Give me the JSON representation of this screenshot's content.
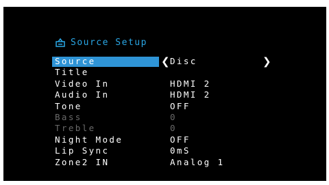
{
  "header": {
    "title": "Source Setup",
    "icon": "source-input-icon",
    "color": "#2aa7e6"
  },
  "selection_color": "#2f94d6",
  "menu": {
    "items": [
      {
        "label": "Source",
        "value": "Disc",
        "selected": true,
        "disabled": false
      },
      {
        "label": "Title",
        "value": "",
        "selected": false,
        "disabled": false
      },
      {
        "label": "Video In",
        "value": "HDMI 2",
        "selected": false,
        "disabled": false
      },
      {
        "label": "Audio In",
        "value": "HDMI 2",
        "selected": false,
        "disabled": false
      },
      {
        "label": "Tone",
        "value": "OFF",
        "selected": false,
        "disabled": false
      },
      {
        "label": "Bass",
        "value": "0",
        "selected": false,
        "disabled": true
      },
      {
        "label": "Treble",
        "value": "0",
        "selected": false,
        "disabled": true
      },
      {
        "label": "Night Mode",
        "value": "OFF",
        "selected": false,
        "disabled": false
      },
      {
        "label": "Lip Sync",
        "value": "0mS",
        "selected": false,
        "disabled": false
      },
      {
        "label": "Zone2 IN",
        "value": "Analog 1",
        "selected": false,
        "disabled": false
      }
    ],
    "arrow_left": "❮",
    "arrow_right": "❯"
  }
}
